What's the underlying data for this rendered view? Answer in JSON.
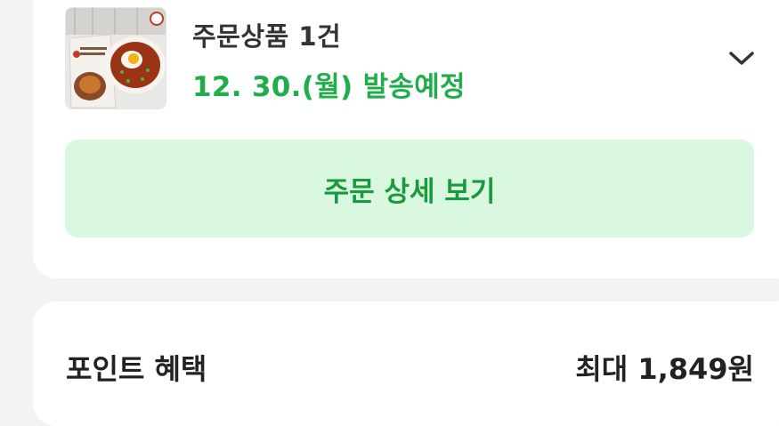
{
  "order": {
    "title": "주문상품 1건",
    "shipping_status": "12. 30.(월) 발송예정",
    "detail_button_label": "주문 상세 보기",
    "expand_icon": "chevron-down-icon",
    "accent_color": "#1fae4a"
  },
  "benefits": {
    "label": "포인트 혜택",
    "value": "최대 1,849원"
  }
}
